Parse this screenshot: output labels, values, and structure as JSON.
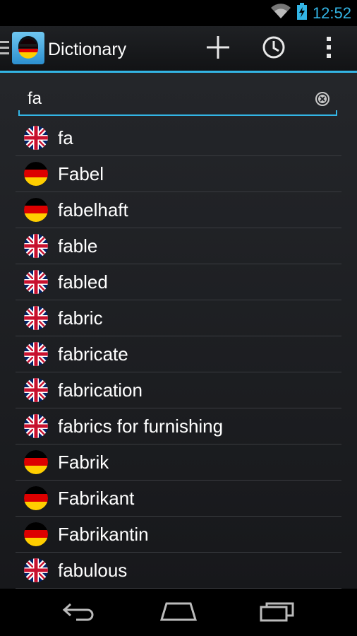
{
  "status": {
    "time": "12:52",
    "wifi_icon": "wifi-icon",
    "battery_icon": "battery-charging-icon"
  },
  "actionbar": {
    "title": "Dictionary",
    "add_icon": "plus-icon",
    "history_icon": "clock-icon",
    "overflow_icon": "more-vertical-icon",
    "accent": "#33b5e5"
  },
  "search": {
    "value": "fa",
    "clear_icon": "clear-icon"
  },
  "results": [
    {
      "word": "fa",
      "lang": "en"
    },
    {
      "word": "Fabel",
      "lang": "de"
    },
    {
      "word": "fabelhaft",
      "lang": "de"
    },
    {
      "word": "fable",
      "lang": "en"
    },
    {
      "word": "fabled",
      "lang": "en"
    },
    {
      "word": "fabric",
      "lang": "en"
    },
    {
      "word": "fabricate",
      "lang": "en"
    },
    {
      "word": "fabrication",
      "lang": "en"
    },
    {
      "word": "fabrics for furnishing",
      "lang": "en"
    },
    {
      "word": "Fabrik",
      "lang": "de"
    },
    {
      "word": "Fabrikant",
      "lang": "de"
    },
    {
      "word": "Fabrikantin",
      "lang": "de"
    },
    {
      "word": "fabulous",
      "lang": "en"
    }
  ],
  "navbar": {
    "back_icon": "back-icon",
    "home_icon": "home-icon",
    "recents_icon": "recents-icon"
  }
}
